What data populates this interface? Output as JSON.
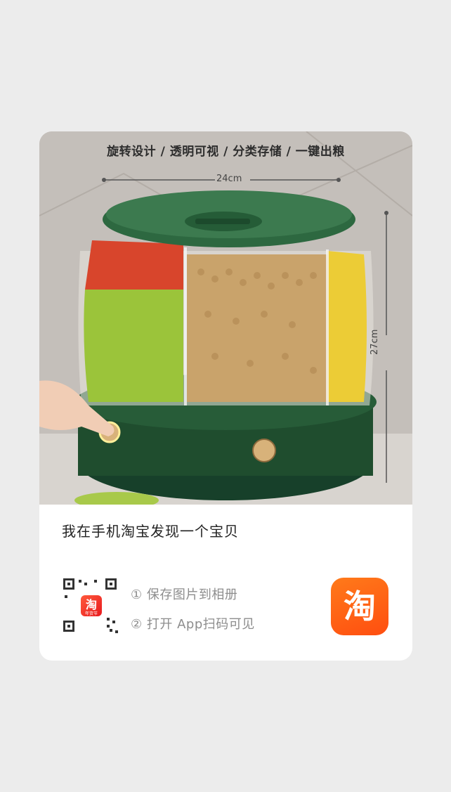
{
  "share_card": {
    "product_image": {
      "caption": "旋转设计 / 透明可视 / 分类存储 / 一键出粮",
      "width_label": "24cm",
      "height_label": "27cm"
    },
    "title": "我在手机淘宝发现一个宝贝",
    "qr_badge_text": "淘",
    "qr_badge_sub": "年货节",
    "steps": [
      "① 保存图片到相册",
      "② 打开 App扫码可见"
    ],
    "app_logo_text": "淘"
  },
  "colors": {
    "background": "#ececec",
    "card": "#ffffff",
    "bin_green": "#1f4d2e",
    "taobao_orange": "#ff5a10"
  }
}
